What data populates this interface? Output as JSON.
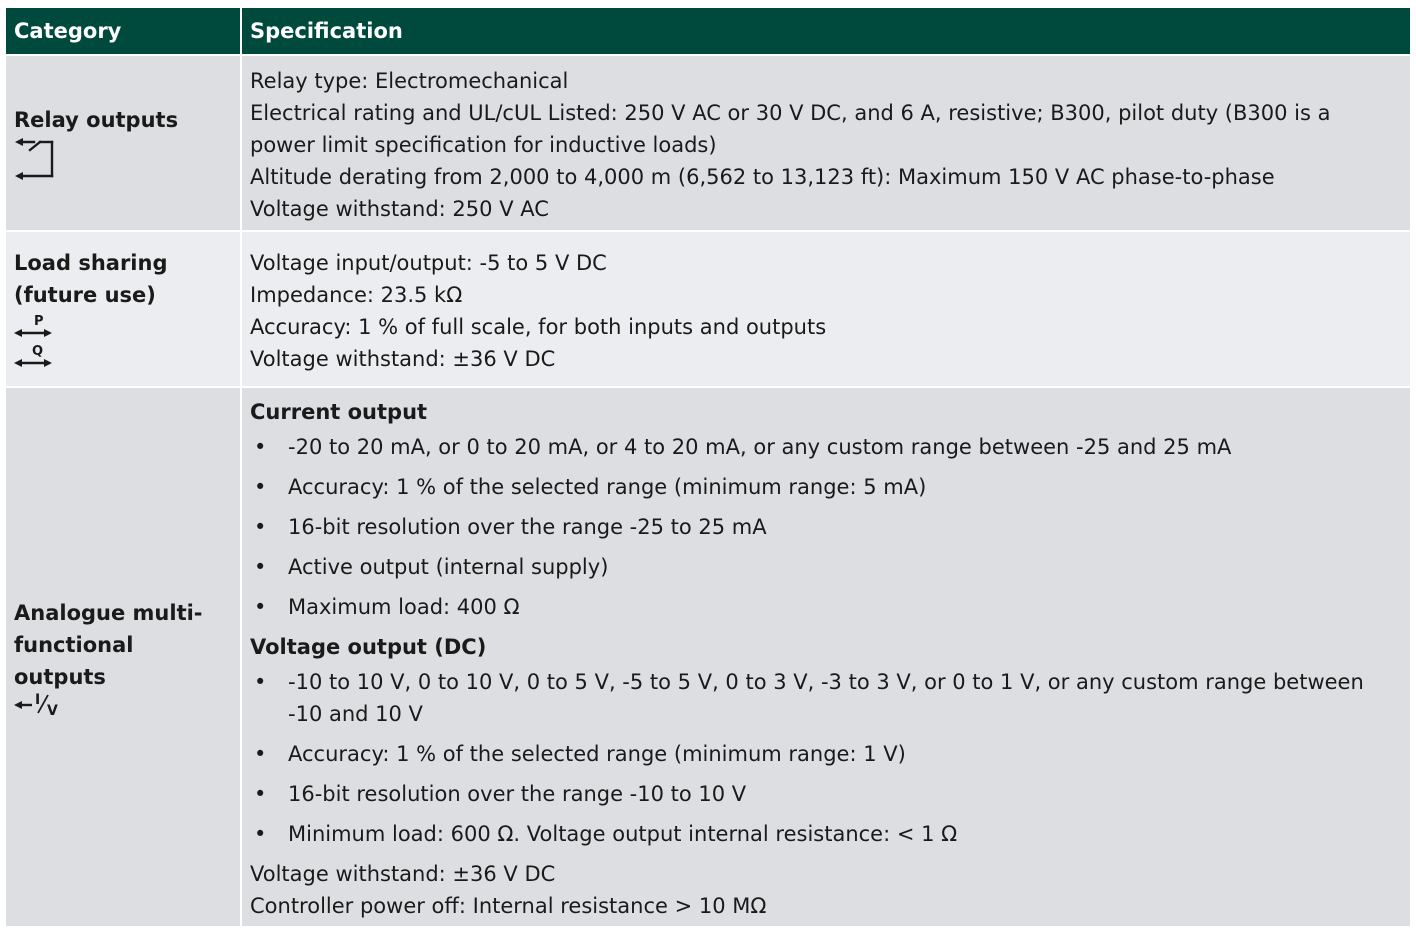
{
  "header": {
    "category": "Category",
    "specification": "Specification"
  },
  "rows": {
    "relay": {
      "category": "Relay outputs",
      "icon": "relay-contact-icon",
      "lines": [
        "Relay type: Electromechanical",
        "Electrical rating and UL/cUL Listed: 250 V AC or 30 V DC, and 6 A, resistive; B300, pilot duty (B300 is a power limit specification for inductive loads)",
        "Altitude derating from 2,000 to 4,000 m (6,562 to 13,123 ft): Maximum 150 V AC phase-to-phase",
        "Voltage withstand: 250 V AC"
      ]
    },
    "load": {
      "category_line1": "Load sharing",
      "category_line2": "(future use)",
      "icon_p_label": "P",
      "icon_q_label": "Q",
      "lines": [
        "Voltage input/output: -5 to 5 V DC",
        "Impedance: 23.5 kΩ",
        "Accuracy: 1 % of full scale, for both inputs and outputs",
        "Voltage withstand: ±36 V DC"
      ]
    },
    "analogue": {
      "category_line1": "Analogue multi-",
      "category_line2": "functional outputs",
      "icon_i_label": "I",
      "icon_v_label": "V",
      "current_heading": "Current output",
      "current_bullets": [
        "-20 to 20 mA, or 0 to 20 mA, or 4 to 20 mA, or any custom range between -25 and 25 mA",
        "Accuracy: 1 % of the selected range (minimum range: 5 mA)",
        "16-bit resolution over the range -25 to 25 mA",
        "Active output (internal supply)",
        "Maximum load: 400 Ω"
      ],
      "voltage_heading": "Voltage output (DC)",
      "voltage_bullets": [
        "-10 to 10 V, 0 to 10 V, 0 to 5 V, -5 to 5 V, 0 to 3 V, -3 to 3 V, or 0 to 1 V, or any custom range between -10 and 10 V",
        "Accuracy: 1 % of the selected range (minimum range: 1 V)",
        "16-bit resolution over the range -10 to 10 V",
        "Minimum load: 600 Ω. Voltage output internal resistance: < 1 Ω"
      ],
      "footer_lines": [
        "Voltage withstand: ±36 V DC",
        "Controller power off: Internal resistance > 10 MΩ"
      ]
    }
  },
  "bullet_char": "•",
  "colors": {
    "header_bg": "#004a3d",
    "header_text": "#ffffff",
    "row_dark": "#dcdee2",
    "row_light": "#ecedf0"
  }
}
